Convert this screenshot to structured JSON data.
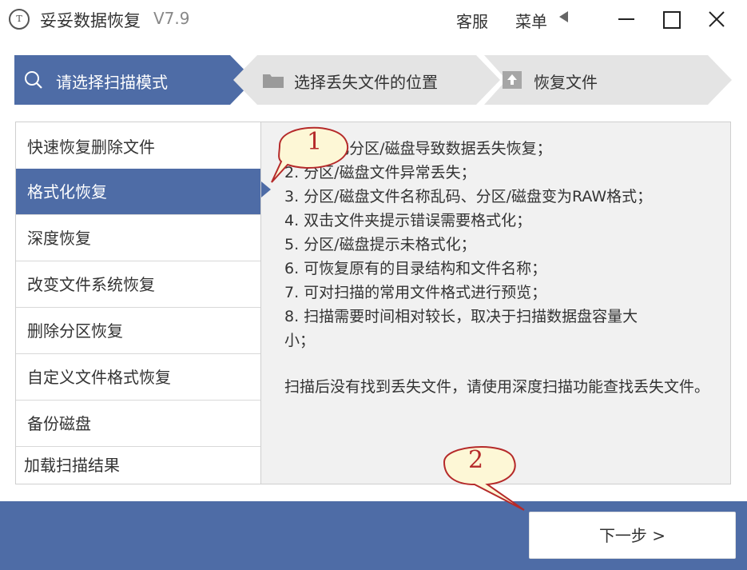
{
  "titlebar": {
    "app_title": "妥妥数据恢复",
    "version": "V7.9",
    "logo_text": "T",
    "service_label": "客服",
    "menu_label": "菜单"
  },
  "steps": [
    {
      "label": "请选择扫描模式",
      "icon": "search-icon",
      "active": true
    },
    {
      "label": "选择丢失文件的位置",
      "icon": "folder-icon",
      "active": false
    },
    {
      "label": "恢复文件",
      "icon": "upload-icon",
      "active": false
    }
  ],
  "modes": [
    {
      "label": "快速恢复删除文件",
      "selected": false
    },
    {
      "label": "格式化恢复",
      "selected": true
    },
    {
      "label": "深度恢复",
      "selected": false
    },
    {
      "label": "改变文件系统恢复",
      "selected": false
    },
    {
      "label": "删除分区恢复",
      "selected": false
    },
    {
      "label": "自定义文件格式恢复",
      "selected": false
    },
    {
      "label": "备份磁盘",
      "selected": false
    },
    {
      "label": "加载扫描结果",
      "selected": false
    }
  ],
  "description": {
    "lines": [
      "1. 格式化分区/磁盘导致数据丢失恢复；",
      "2. 分区/磁盘文件异常丢失；",
      "3. 分区/磁盘文件名称乱码、分区/磁盘变为RAW格式；",
      "4. 双击文件夹提示错误需要格式化；",
      "5. 分区/磁盘提示未格式化；",
      "6. 可恢复原有的目录结构和文件名称；",
      "7. 可对扫描的常用文件格式进行预览；",
      "8. 扫描需要时间相对较长，取决于扫描数据盘容量大",
      "小；"
    ],
    "note": "扫描后没有找到丢失文件，请使用深度扫描功能查找丢失文件。"
  },
  "next_button": "下一步 >",
  "callouts": [
    {
      "number": "1"
    },
    {
      "number": "2"
    }
  ],
  "colors": {
    "accent": "#4e6ca6",
    "step_inactive": "#e7e7e7",
    "callout_fill": "#fdf7d6",
    "callout_stroke": "#b52a2a"
  }
}
